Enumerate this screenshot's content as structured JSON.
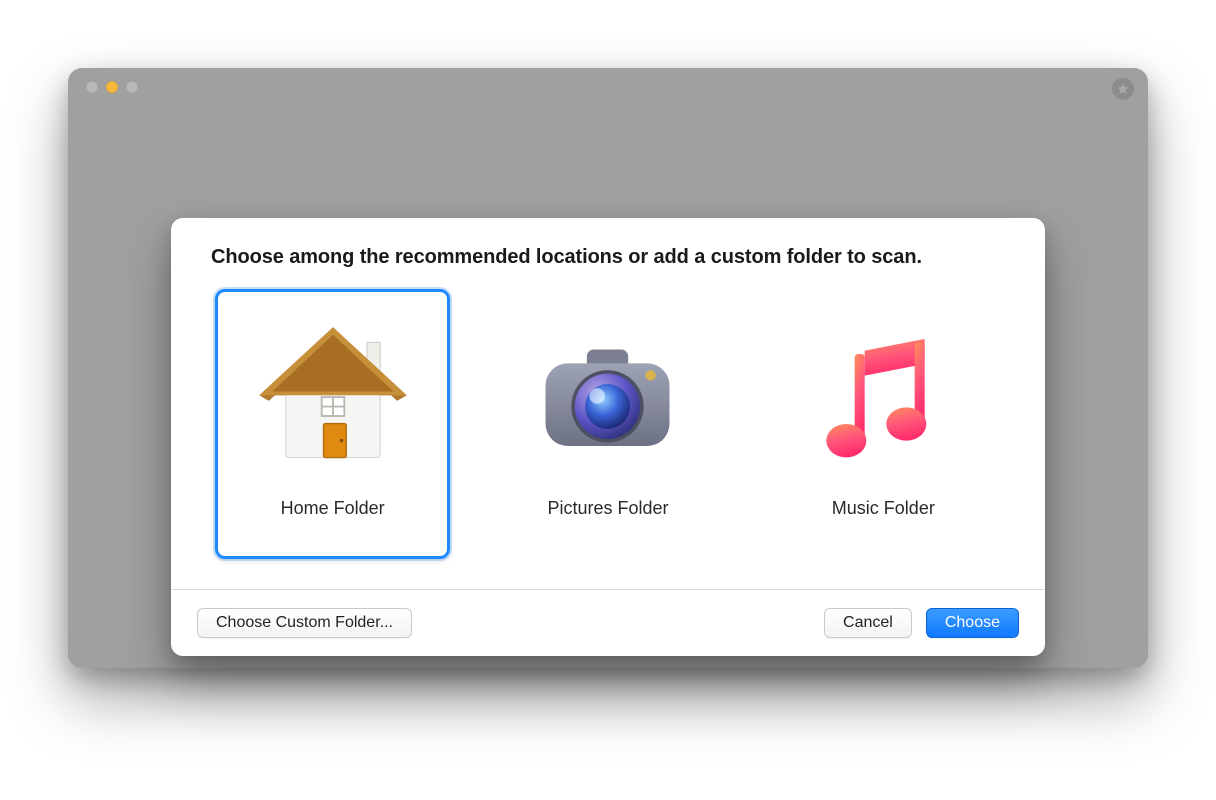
{
  "sheet": {
    "title": "Choose among the recommended locations or add a custom folder to scan.",
    "options": [
      {
        "label": "Home Folder",
        "icon": "home-folder-icon",
        "selected": true
      },
      {
        "label": "Pictures Folder",
        "icon": "pictures-folder-icon",
        "selected": false
      },
      {
        "label": "Music Folder",
        "icon": "music-folder-icon",
        "selected": false
      }
    ],
    "buttons": {
      "custom": "Choose Custom Folder...",
      "cancel": "Cancel",
      "confirm": "Choose"
    }
  },
  "colors": {
    "accent": "#107aff",
    "selection_border": "#1e88ff"
  }
}
